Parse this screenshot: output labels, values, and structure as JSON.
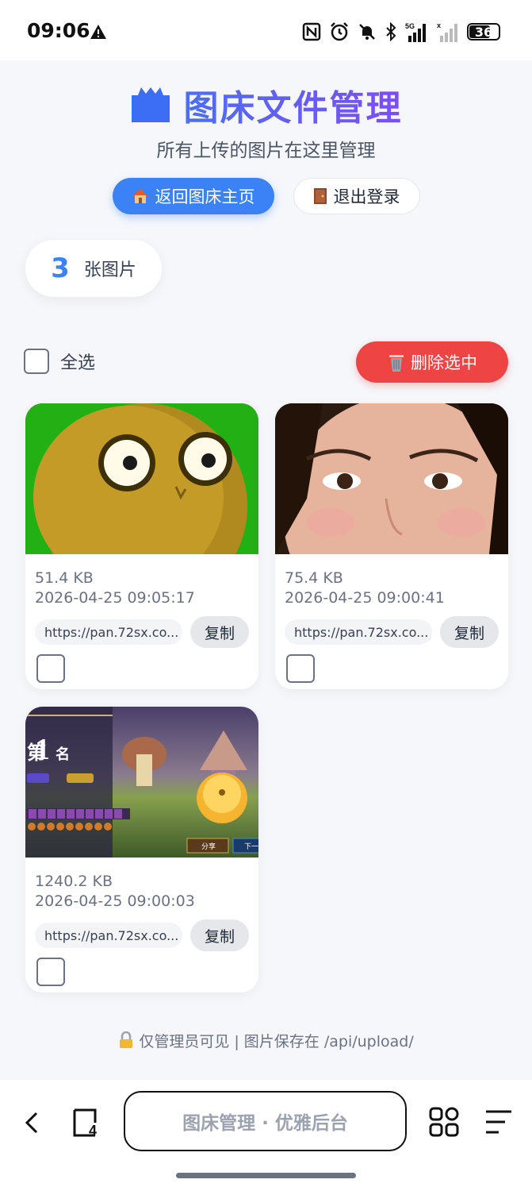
{
  "status_bar": {
    "time": "09:06",
    "battery": "36"
  },
  "header": {
    "title": "图床文件管理",
    "subtitle": "所有上传的图片在这里管理"
  },
  "buttons": {
    "home_label": "返回图床主页",
    "logout_label": "退出登录"
  },
  "summary": {
    "count": "3",
    "count_label": "张图片"
  },
  "toolbar": {
    "select_all_label": "全选",
    "delete_selected_label": "删除选中"
  },
  "images": [
    {
      "size": "51.4 KB",
      "date": "2026-04-25 09:05:17",
      "url": "https://pan.72sx.co...",
      "copy_label": "复制"
    },
    {
      "size": "75.4 KB",
      "date": "2026-04-25 09:00:41",
      "url": "https://pan.72sx.co...",
      "copy_label": "复制"
    },
    {
      "size": "1240.2 KB",
      "date": "2026-04-25 09:00:03",
      "url": "https://pan.72sx.co...",
      "copy_label": "复制"
    }
  ],
  "game_thumb": {
    "rank_prefix": "第",
    "rank_number": "1",
    "rank_suffix": "名",
    "share_label": "分享",
    "next_label": "下一"
  },
  "footer": {
    "note": "仅管理员可见 | 图片保存在 /api/upload/"
  },
  "browser": {
    "address": "图床管理 · 优雅后台"
  },
  "colors": {
    "primary": "#3b82f6",
    "danger": "#ef4444",
    "background": "#f5f7fb"
  }
}
